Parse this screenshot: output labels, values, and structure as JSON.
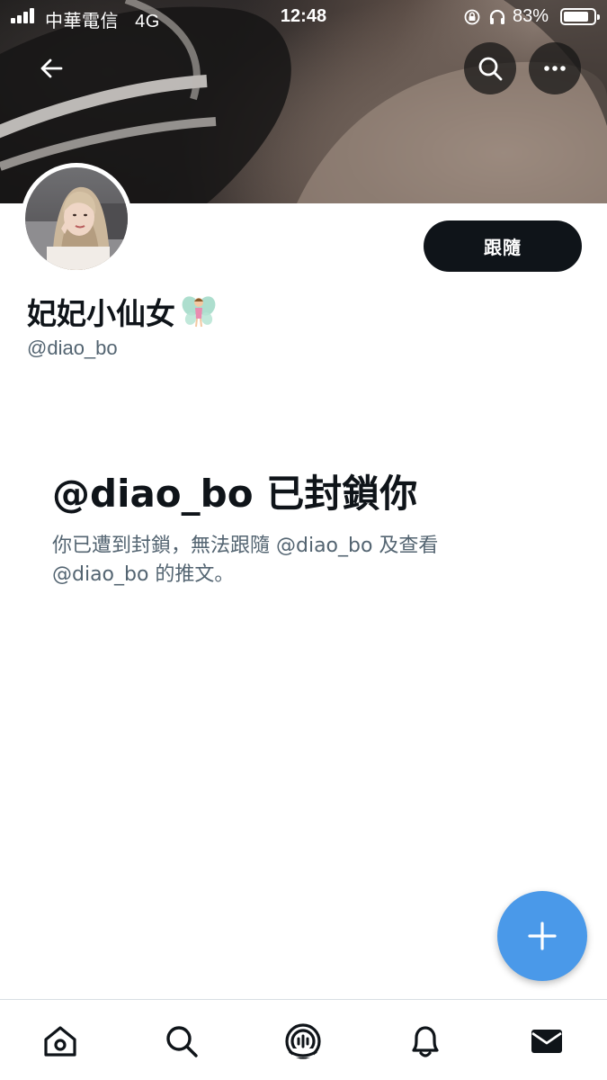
{
  "status_bar": {
    "carrier": "中華電信",
    "network": "4G",
    "time": "12:48",
    "battery_percent": "83%",
    "battery_level": 0.83
  },
  "header": {
    "back_icon": "arrow-left-icon",
    "search_icon": "search-icon",
    "more_icon": "more-horizontal-icon"
  },
  "profile": {
    "display_name": "妃妃小仙女",
    "name_emoji": "fairy-icon",
    "handle": "@diao_bo",
    "follow_label": "跟隨"
  },
  "blocked_notice": {
    "title": "@diao_bo 已封鎖你",
    "description": "你已遭到封鎖，無法跟隨 @diao_bo 及查看 @diao_bo 的推文。"
  },
  "fab": {
    "icon": "plus-icon",
    "color": "#4a99e9"
  },
  "bottom_nav": {
    "items": [
      {
        "name": "home",
        "icon": "home-icon"
      },
      {
        "name": "search",
        "icon": "search-icon"
      },
      {
        "name": "spaces",
        "icon": "spaces-icon"
      },
      {
        "name": "notifications",
        "icon": "bell-icon"
      },
      {
        "name": "messages",
        "icon": "envelope-icon"
      }
    ]
  },
  "colors": {
    "text_primary": "#0f1419",
    "text_secondary": "#536471",
    "follow_button_bg": "#0f1419",
    "accent_blue": "#4a99e9"
  }
}
